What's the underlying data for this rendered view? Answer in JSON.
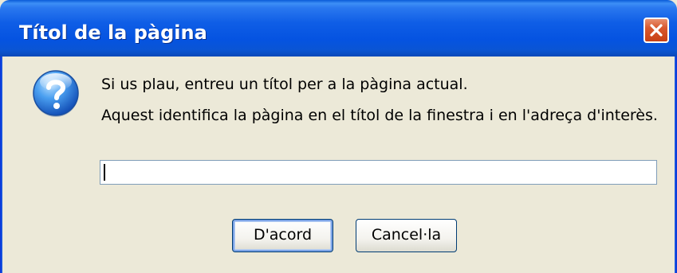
{
  "window": {
    "title": "Títol de la pàgina"
  },
  "icons": {
    "title_close": "close-icon",
    "dialog_icon": "question-icon"
  },
  "message": {
    "line1": "Si us plau, entreu un títol per a la pàgina actual.",
    "line2": "Aquest identifica la pàgina en el títol de la finestra i en l'adreça d'interès."
  },
  "input": {
    "value": "",
    "placeholder": ""
  },
  "buttons": {
    "ok_label": "D'acord",
    "cancel_label": "Cancel·la"
  },
  "colors": {
    "titlebar": "#0553e1",
    "close_button": "#d8582e",
    "dialog_background": "#ece9d8",
    "input_border": "#7f9db9"
  }
}
